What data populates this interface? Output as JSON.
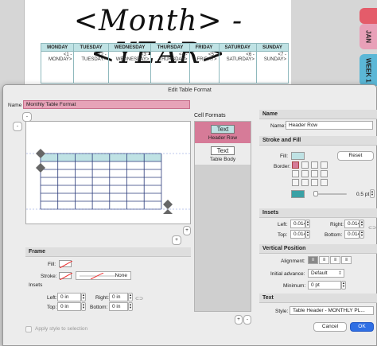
{
  "planner": {
    "title": "<Month> - <YEAR>",
    "days": [
      "MONDAY",
      "TUESDAY",
      "WEDNESDAY",
      "THURSDAY",
      "FRIDAY",
      "SATURDAY",
      "SUNDAY"
    ],
    "cells": [
      "<1 - MONDAY>",
      "<2 - TUESDAY>",
      "<3 - WEDNESDAY>",
      "<4 - THURSDAY>",
      "<5 - FRIDAY>",
      "<6 - SATURDAY>",
      "<7 - SUNDAY>"
    ],
    "tab_jan": "JAN",
    "tab_week": "WEEK 1",
    "tab_colors": {
      "red": "#e45c6a",
      "jan": "#e8a0b8",
      "week": "#5bb7d6"
    }
  },
  "dialog": {
    "title": "Edit Table Format",
    "name_label": "Name",
    "name_value": "Monthly Table Format",
    "minus": "-",
    "plus": "+",
    "cell_formats_heading": "Cell Formats",
    "formats": [
      {
        "sample": "Text",
        "label": "Header Row"
      },
      {
        "sample": "Text",
        "label": "Table Body"
      }
    ],
    "frame": {
      "heading": "Frame",
      "fill_label": "Fill:",
      "stroke_label": "Stroke:",
      "stroke_value": "None",
      "insets_heading": "Insets",
      "left_label": "Left:",
      "left_value": "0 in",
      "top_label": "Top:",
      "top_value": "0 in",
      "right_label": "Right:",
      "right_value": "0 in",
      "bottom_label": "Bottom:",
      "bottom_value": "0 in"
    },
    "apply_style": "Apply style to selection",
    "right": {
      "name_heading": "Name",
      "name_label": "Name:",
      "name_value": "Header Row",
      "stroke_fill_heading": "Stroke and Fill",
      "fill_label": "Fill:",
      "reset_label": "Reset",
      "border_label": "Border:",
      "stroke_width": "0.5 pt",
      "insets_heading": "Insets",
      "left_label": "Left:",
      "left_value": "0.014 i",
      "top_label": "Top:",
      "top_value": "0.014 i",
      "right_label": "Right:",
      "right_value": "0.014 i",
      "bottom_label": "Bottom:",
      "bottom_value": "0.014 i",
      "vpos_heading": "Vertical Position",
      "alignment_label": "Alignment:",
      "initial_advance_label": "Initial advance:",
      "initial_advance_value": "Default",
      "minimum_label": "Minimum:",
      "minimum_value": "0 pt",
      "text_heading": "Text",
      "style_label": "Style:",
      "style_value": "Table Header - MONTHLY PL...",
      "cancel_label": "Cancel",
      "ok_label": "OK"
    },
    "colors": {
      "header_fill": "#bfe2e4",
      "teal": "#3aa1a5",
      "selected_format": "#d67b98"
    }
  }
}
